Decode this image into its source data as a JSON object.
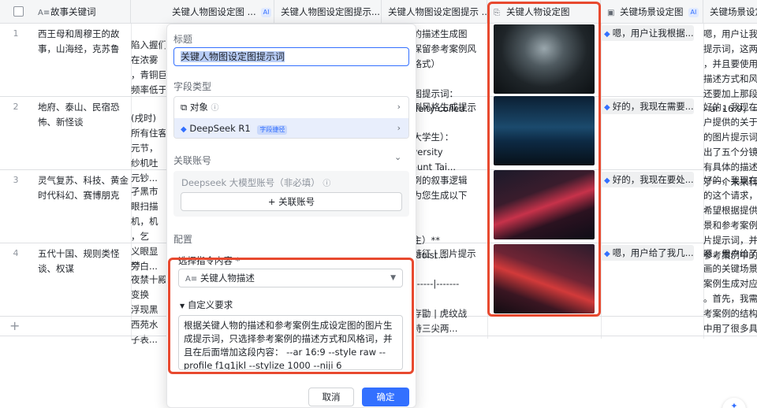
{
  "header": {
    "col1": "故事关键词",
    "col2": "关键人物图设定图 ...",
    "col3": "关键人物图设定图提示...",
    "col4": "关键人物图设定图提示 ...",
    "col5": "关键人物设定图",
    "col6": "关键场景设定图",
    "col7": "关键场景设定",
    "ai_badge": "AI"
  },
  "rows": [
    {
      "num": "1",
      "keywords": "西王母和周穆王的故事，山海经，克苏鲁",
      "c2": "陷入握们\n在浓雾\n，青铜巨\n频率低于",
      "c4": "物的描述生成图\n（保留参考案例风\n故格式）\n\n定图提示词：\ne deity coiled...",
      "chip": "嗯，用户让我根据...",
      "c6": "嗯，用户让我\n提示词，这两\n，并且要使用\n描述方式和风\n还要加上那段\n--ar 16:9，--s"
    },
    {
      "num": "2",
      "keywords": "地府、泰山、民宿恐怖、新怪谈",
      "c2": "(戌时)\n所有住客\n元节，\n纱机吐\n元钞...",
      "c4": "案例风格生成提示\n\n女大学生）：\nniversity\nMount Tai...",
      "chip": "好的，我现在需要...",
      "c6": "好的，我现在\n户提供的关于\n的图片提示词\n出了五个分镜\n有具体的描述\n了一个未来科"
    },
    {
      "num": "3",
      "keywords": "灵气复苏、科技、黄金时代科幻、赛博朋克",
      "c2": "孑黑市\n眼扫描\n机，机\n，乞\n义眼显\n旁白...",
      "c4": "案例的叙事逻辑\n，为您生成以下\n词：\n\n目主）**\nk Taoist...",
      "chip": "好的，我现在要处...",
      "c6": "好的，我现在\n的这个请求，\n希望根据提供\n景和参考案例\n片提示词，并\n参考案例中的"
    },
    {
      "num": "4",
      "keywords": "五代十国、规则类怪谈、权谋",
      "c2": "**\n夜禁十殿\n变换\n浮现黑\n西苑水\n子表...",
      "c4": "象特征 | 图片提示\n\n---------|-------\n\n李存勖 | 虎纹战\n手持三尖两...",
      "chip": "嗯，用户给了我几...",
      "c6": "嗯，用户给了\n画的关键场景\n案例生成对应\n。首先，我需\n考案例的结构\n中用了很多具"
    }
  ],
  "dialog": {
    "title_label": "标题",
    "title_value": "关键人物图设定图提示词",
    "field_type_label": "字段类型",
    "type_object": "对象",
    "type_model": "DeepSeek R1",
    "type_model_tag": "字段捷径",
    "linked_account_label": "关联账号",
    "account_field_label": "Deepseek 大模型账号（非必填）",
    "link_account_button": "+ 关联账号",
    "config_label": "配置",
    "select_label": "选择指令内容 *",
    "select_value": "关键人物描述",
    "custom_label": "自定义要求",
    "custom_text": "根据关键人物的描述和参考案例生成设定图的图片生成提示词，只选择参考案例的描述方式和风格词，并且在后面增加这段内容： --ar 16:9 --style raw --profile f1q1jkl --stylize 1000 --niji 6",
    "cancel": "取消",
    "confirm": "确定"
  },
  "colors": {
    "accent": "#3370ff",
    "highlight": "#e8492f"
  }
}
